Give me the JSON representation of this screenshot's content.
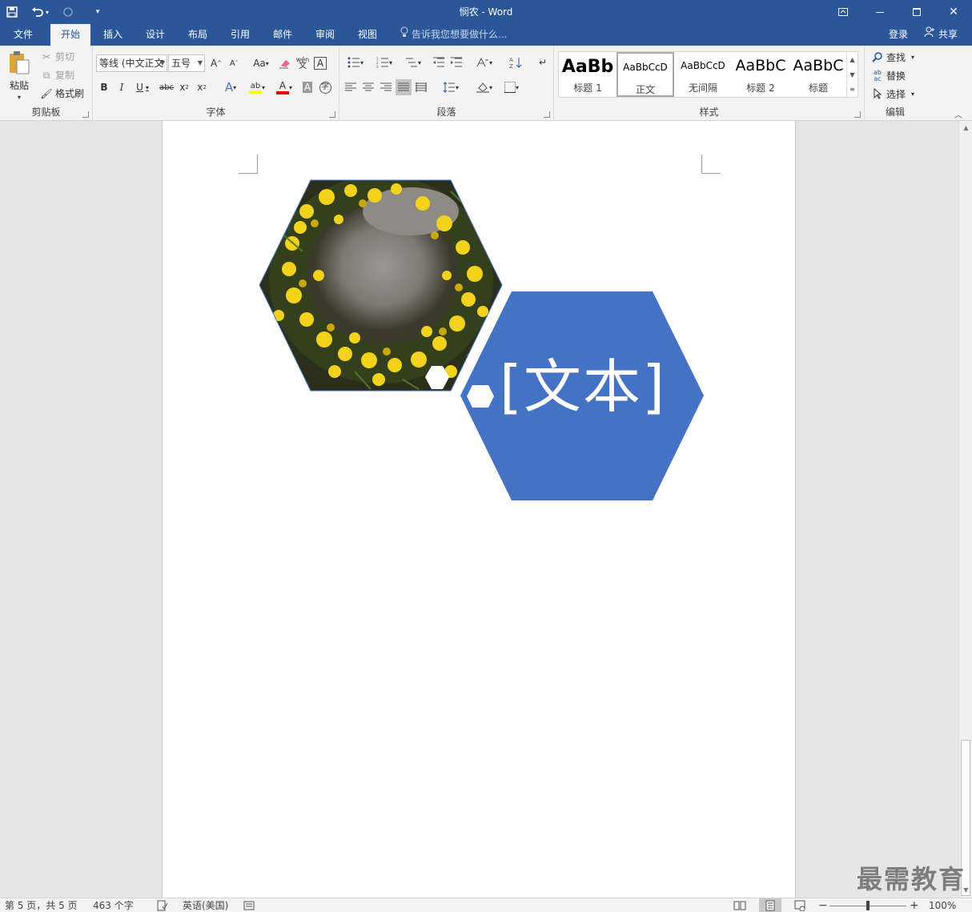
{
  "window": {
    "title": "悯农 - Word",
    "qat": {
      "save_icon": "save-icon",
      "undo_icon": "undo-icon",
      "redo_icon": "redo-icon",
      "customize_icon": "customize-qat-icon"
    }
  },
  "tabs": [
    "文件",
    "开始",
    "插入",
    "设计",
    "布局",
    "引用",
    "邮件",
    "审阅",
    "视图"
  ],
  "active_tab": "开始",
  "tell_me": "告诉我您想要做什么...",
  "account": {
    "login": "登录",
    "share": "共享"
  },
  "ribbon": {
    "clipboard": {
      "label": "剪贴板",
      "paste": "粘贴",
      "cut": "剪切",
      "copy": "复制",
      "format_painter": "格式刷"
    },
    "font": {
      "label": "字体",
      "font_name": "等线 (中文正文",
      "font_size": "五号",
      "buttons": {
        "grow": "A",
        "shrink": "A",
        "case": "Aa",
        "phonetic": "wén",
        "border": "A",
        "bold": "B",
        "italic": "I",
        "underline": "U",
        "strike": "abc",
        "sub": "x",
        "sup": "x",
        "effects": "A",
        "font_color": "A",
        "shading": "A",
        "enclose": "字"
      }
    },
    "paragraph": {
      "label": "段落"
    },
    "styles": {
      "label": "样式",
      "items": [
        {
          "preview": "AaBb",
          "name": "标题 1"
        },
        {
          "preview": "AaBbCcD",
          "name": "正文"
        },
        {
          "preview": "AaBbCcD",
          "name": "无间隔"
        },
        {
          "preview": "AaBbC",
          "name": "标题 2"
        },
        {
          "preview": "AaBbC",
          "name": "标题"
        }
      ]
    },
    "editing": {
      "label": "编辑",
      "find": "查找",
      "replace": "替换",
      "select": "选择"
    }
  },
  "document": {
    "shape_text": "[文本]",
    "image_desc": "yellow-flower-wreath-photo",
    "colors": {
      "hex_blue": "#4472c4",
      "accent": "#2b579a"
    }
  },
  "status": {
    "page": "第 5 页，共 5 页",
    "words": "463 个字",
    "language": "英语(美国)",
    "zoom": "100%"
  },
  "watermark": "最需教育"
}
